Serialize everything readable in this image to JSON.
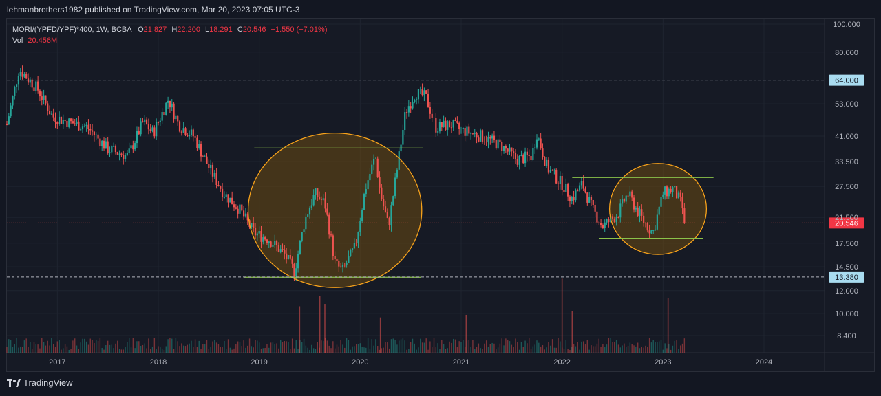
{
  "publisher": "lehmanbrothers1982 published on TradingView.com, Mar 20, 2023 07:05 UTC-3",
  "legend": {
    "symbol": "MORI/(YPFD/YPF)*400, 1W, BCBA",
    "o_label": "O",
    "o": "21.827",
    "h_label": "H",
    "h": "22.200",
    "l_label": "L",
    "l": "18.291",
    "c_label": "C",
    "c": "20.546",
    "change": "−1.550 (−7.01%)",
    "vol_label": "Vol",
    "vol": "20.456M"
  },
  "footer": {
    "brand": "TradingView",
    "icon": "tradingview-logo-icon"
  },
  "colors": {
    "up": "#26a69a",
    "down": "#ef5350",
    "background": "#131722",
    "circle_stroke": "#f7a21b",
    "circle_fill": "#6b4a12",
    "support_line": "#8bc34a"
  },
  "chart_data": {
    "type": "candlestick",
    "scale": "log",
    "interval": "1W",
    "ylim": [
      8.4,
      100
    ],
    "y_ticks": [
      "100.000",
      "80.000",
      "64.000",
      "53.000",
      "41.000",
      "33.500",
      "27.500",
      "21.500",
      "17.500",
      "14.500",
      "12.000",
      "10.000",
      "8.400"
    ],
    "x_ticks": [
      "2017",
      "2018",
      "2019",
      "2020",
      "2021",
      "2022",
      "2023",
      "2024"
    ],
    "x_range": [
      2016.5,
      2024.6
    ],
    "price_labels": [
      {
        "name": "resistance",
        "value": 64.0,
        "text": "64.000"
      },
      {
        "name": "last",
        "value": 20.546,
        "text": "20.546"
      },
      {
        "name": "support",
        "value": 13.38,
        "text": "13.380"
      }
    ],
    "series": [
      {
        "name": "close",
        "points": [
          [
            2016.5,
            45
          ],
          [
            2016.62,
            70
          ],
          [
            2016.8,
            60
          ],
          [
            2016.95,
            48
          ],
          [
            2017.1,
            46
          ],
          [
            2017.3,
            44
          ],
          [
            2017.5,
            37
          ],
          [
            2017.7,
            35
          ],
          [
            2017.85,
            46
          ],
          [
            2017.95,
            42
          ],
          [
            2018.1,
            55
          ],
          [
            2018.2,
            45
          ],
          [
            2018.35,
            41
          ],
          [
            2018.5,
            32
          ],
          [
            2018.65,
            26
          ],
          [
            2018.8,
            23
          ],
          [
            2018.95,
            19
          ],
          [
            2019.1,
            18
          ],
          [
            2019.25,
            16
          ],
          [
            2019.35,
            14
          ],
          [
            2019.45,
            21
          ],
          [
            2019.55,
            26
          ],
          [
            2019.65,
            24
          ],
          [
            2019.75,
            15
          ],
          [
            2019.82,
            14
          ],
          [
            2019.95,
            17
          ],
          [
            2020.05,
            27
          ],
          [
            2020.15,
            35
          ],
          [
            2020.2,
            26
          ],
          [
            2020.28,
            20
          ],
          [
            2020.35,
            29
          ],
          [
            2020.45,
            50
          ],
          [
            2020.55,
            58
          ],
          [
            2020.65,
            56
          ],
          [
            2020.75,
            44
          ],
          [
            2020.9,
            45
          ],
          [
            2021.0,
            43
          ],
          [
            2021.2,
            41
          ],
          [
            2021.4,
            38
          ],
          [
            2021.55,
            34
          ],
          [
            2021.7,
            35
          ],
          [
            2021.75,
            42
          ],
          [
            2021.85,
            32
          ],
          [
            2022.0,
            28
          ],
          [
            2022.1,
            25
          ],
          [
            2022.2,
            28
          ],
          [
            2022.3,
            23
          ],
          [
            2022.4,
            20
          ],
          [
            2022.55,
            22
          ],
          [
            2022.65,
            26
          ],
          [
            2022.8,
            21
          ],
          [
            2022.9,
            19
          ],
          [
            2023.0,
            26
          ],
          [
            2023.1,
            27
          ],
          [
            2023.18,
            24
          ],
          [
            2023.23,
            20.546
          ]
        ]
      }
    ],
    "volume_spikes": [
      [
        2019.4,
        10.6
      ],
      [
        2019.6,
        11.5
      ],
      [
        2019.65,
        10.8
      ],
      [
        2020.2,
        9.7
      ],
      [
        2021.05,
        9.9
      ],
      [
        2022.0,
        13.2
      ],
      [
        2022.1,
        10.2
      ],
      [
        2023.05,
        11.3
      ]
    ],
    "annotations": [
      {
        "type": "ellipse",
        "name": "accumulation-zone-1",
        "center": [
          2019.75,
          20
        ],
        "rx_years": 0.86,
        "y_top": 42,
        "y_bottom": 12.3
      },
      {
        "type": "ellipse",
        "name": "accumulation-zone-2",
        "center": [
          2022.95,
          22.5
        ],
        "rx_years": 0.48,
        "y_top": 33,
        "y_bottom": 16
      },
      {
        "type": "segment",
        "name": "range-top-1",
        "from": [
          2018.95,
          37.3
        ],
        "to": [
          2020.62,
          37.3
        ]
      },
      {
        "type": "segment",
        "name": "range-bottom-1",
        "from": [
          2018.85,
          13.35
        ],
        "to": [
          2020.6,
          13.35
        ]
      },
      {
        "type": "segment",
        "name": "range-top-2",
        "from": [
          2022.1,
          29.5
        ],
        "to": [
          2023.5,
          29.5
        ]
      },
      {
        "type": "segment",
        "name": "range-bottom-2",
        "from": [
          2022.37,
          18.2
        ],
        "to": [
          2023.4,
          18.2
        ]
      }
    ]
  }
}
